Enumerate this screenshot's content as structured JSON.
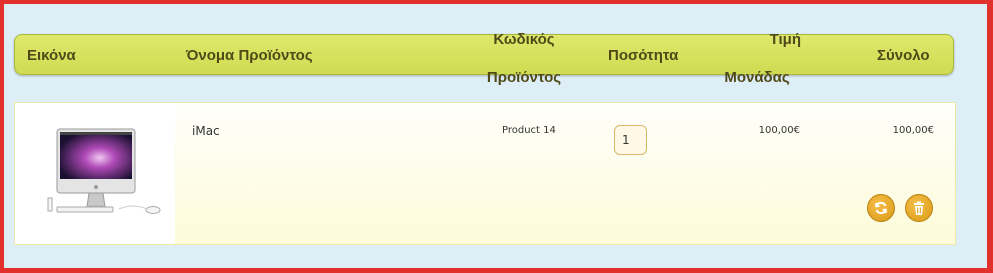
{
  "header": {
    "image": "Εικόνα",
    "name": "Όνομα Προϊόντος",
    "code_line1": "Κωδικός",
    "code_line2": "Προϊόντος",
    "quantity": "Ποσότητα",
    "price_line1": "Τιμή",
    "price_line2": "Μονάδας",
    "total": "Σύνολο"
  },
  "items": [
    {
      "name": "iMac",
      "code": "Product 14",
      "quantity": "1",
      "unit_price": "100,00€",
      "total": "100,00€",
      "image_icon": "imac-product-image"
    }
  ],
  "actions": {
    "refresh_icon": "refresh-icon",
    "delete_icon": "trash-icon"
  },
  "colors": {
    "header_bg": "#d9e25d",
    "header_text": "#4f4a18",
    "button": "#e5a62a",
    "frame_border": "#e2302c"
  }
}
